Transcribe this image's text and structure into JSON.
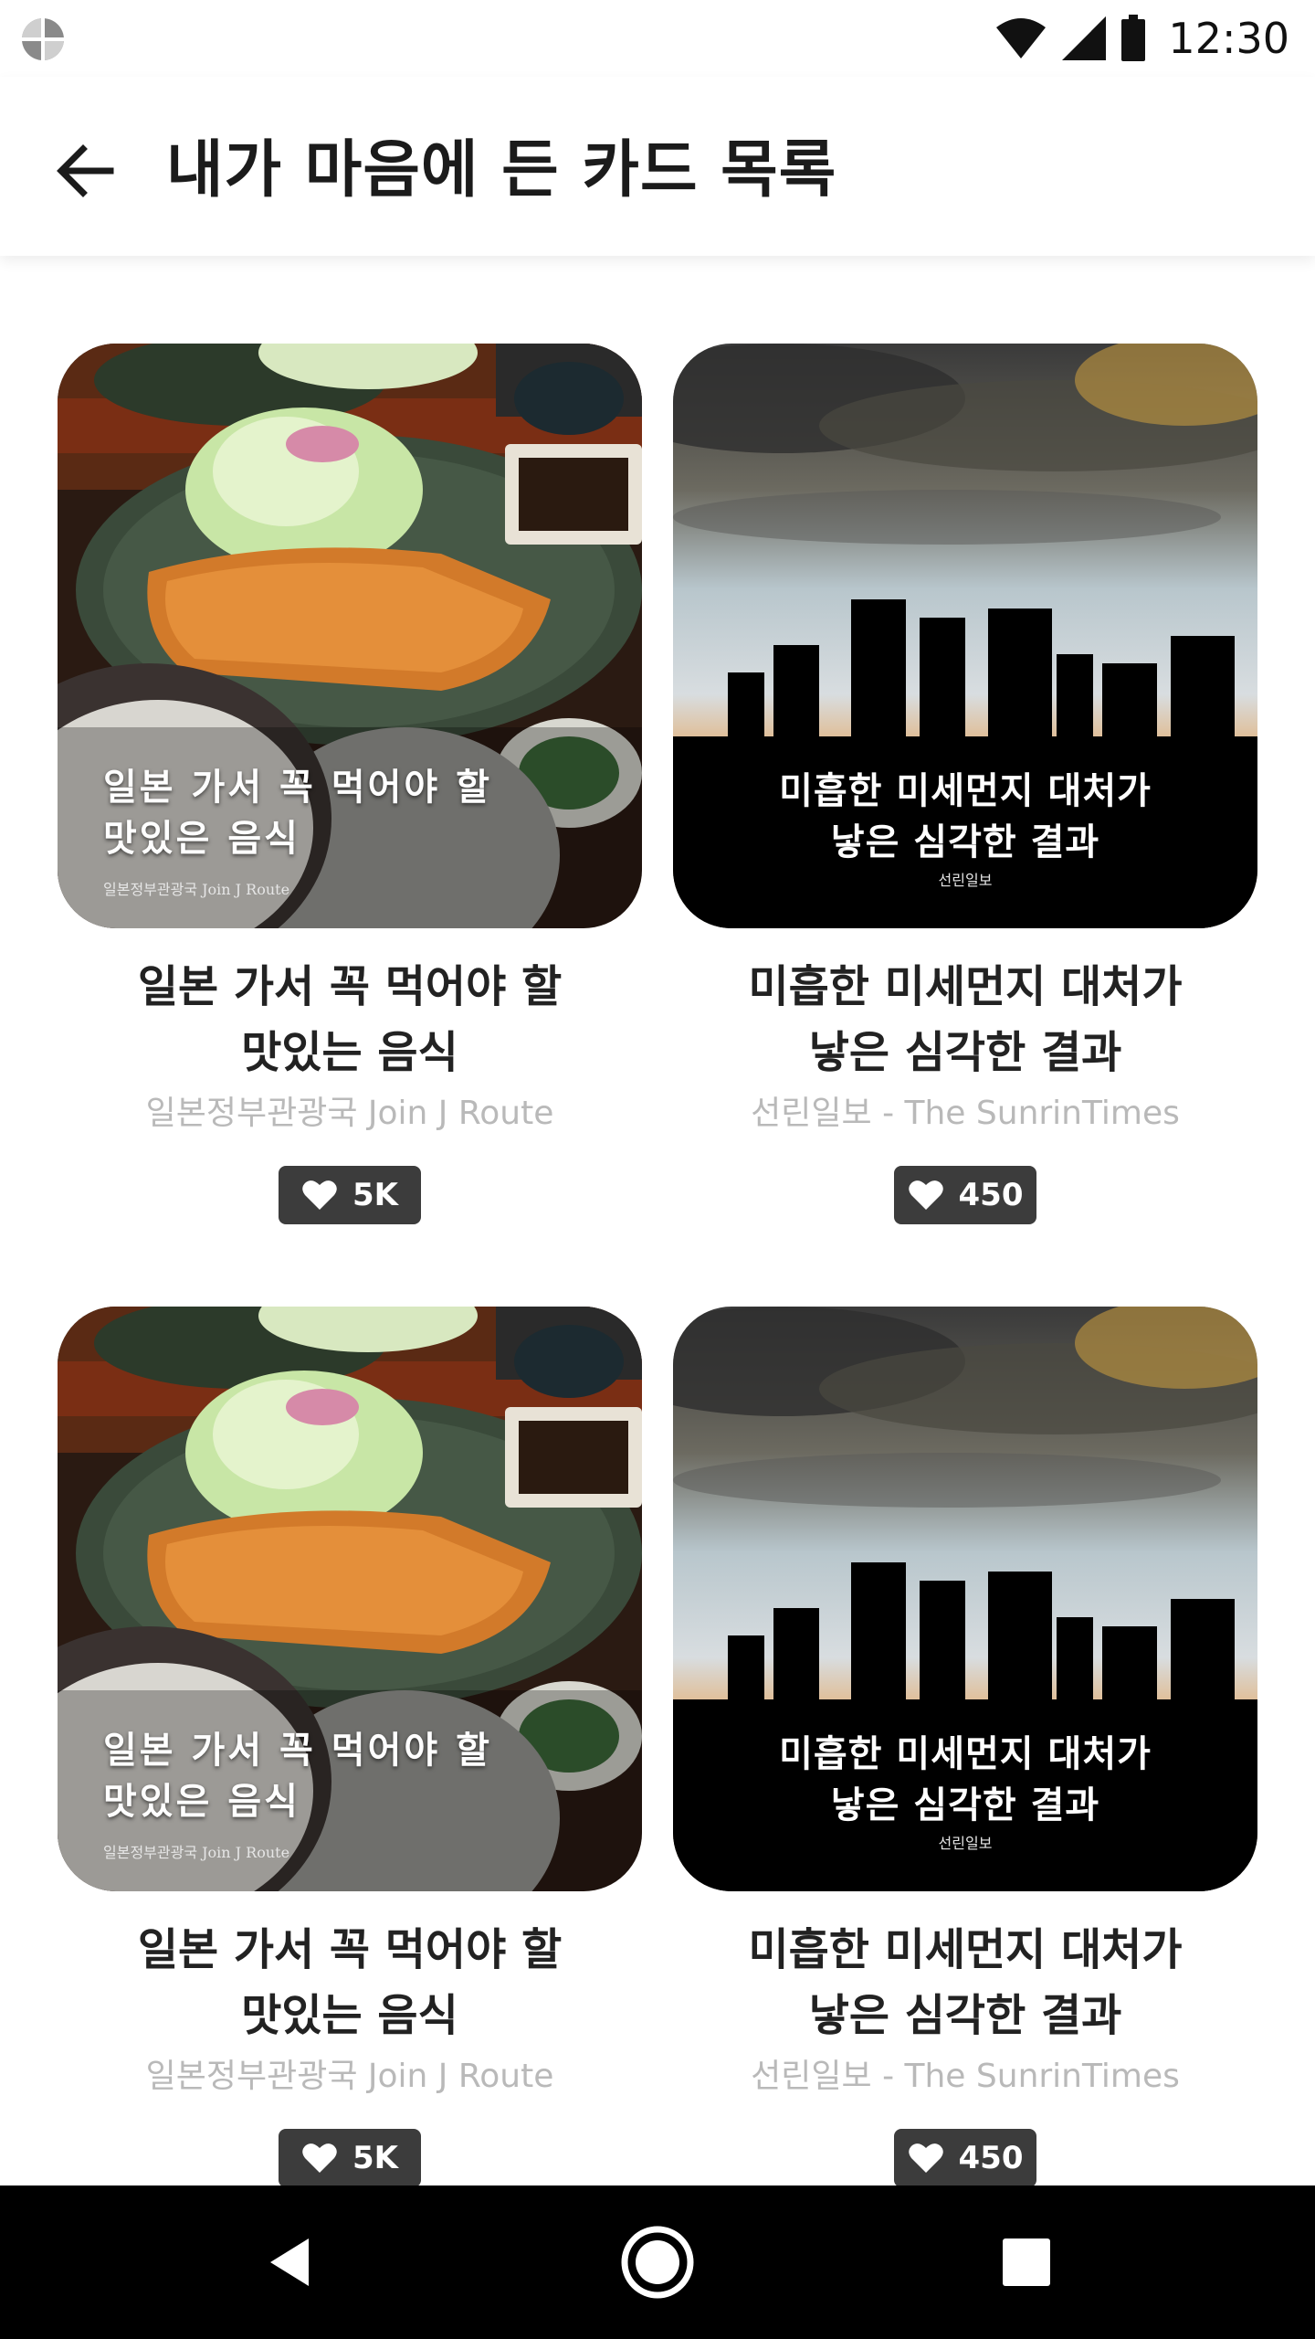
{
  "status_bar": {
    "time": "12:30",
    "icons": [
      "app-logo-icon",
      "wifi-icon",
      "signal-icon",
      "battery-icon"
    ]
  },
  "header": {
    "title": "내가 마음에 든 카드 목록",
    "back_icon": "arrow-left-icon"
  },
  "cards": [
    {
      "overlay_title": "일본 가서 꼭 먹어야 할\n맛있은 음식",
      "overlay_source": "일본정부관광국 Join J Route",
      "title": "일본 가서 꼭 먹어야 할\n맛있는 음식",
      "source": "일본정부관광국 Join J Route",
      "likes": "5K",
      "image": "tonkatsu-photo"
    },
    {
      "overlay_title": "미흡한 미세먼지 대처가\n낳은 심각한 결과",
      "overlay_source": "선린일보",
      "title": "미흡한 미세먼지 대처가\n낳은 심각한 결과",
      "source": "선린일보 - The SunrinTimes",
      "likes": "450",
      "image": "city-skyline-photo"
    },
    {
      "overlay_title": "일본 가서 꼭 먹어야 할\n맛있은 음식",
      "overlay_source": "일본정부관광국 Join J Route",
      "title": "일본 가서 꼭 먹어야 할\n맛있는 음식",
      "source": "일본정부관광국 Join J Route",
      "likes": "5K",
      "image": "tonkatsu-photo"
    },
    {
      "overlay_title": "미흡한 미세먼지 대처가\n낳은 심각한 결과",
      "overlay_source": "선린일보",
      "title": "미흡한 미세먼지 대처가\n낳은 심각한 결과",
      "source": "선린일보 - The SunrinTimes",
      "likes": "450",
      "image": "city-skyline-photo"
    }
  ],
  "nav_bar": {
    "icons": [
      "back-triangle-icon",
      "home-circle-icon",
      "recents-square-icon"
    ]
  },
  "colors": {
    "badge_bg": "#3c3c3c",
    "source_text": "#b9b9b9",
    "nav_bg": "#000000"
  }
}
